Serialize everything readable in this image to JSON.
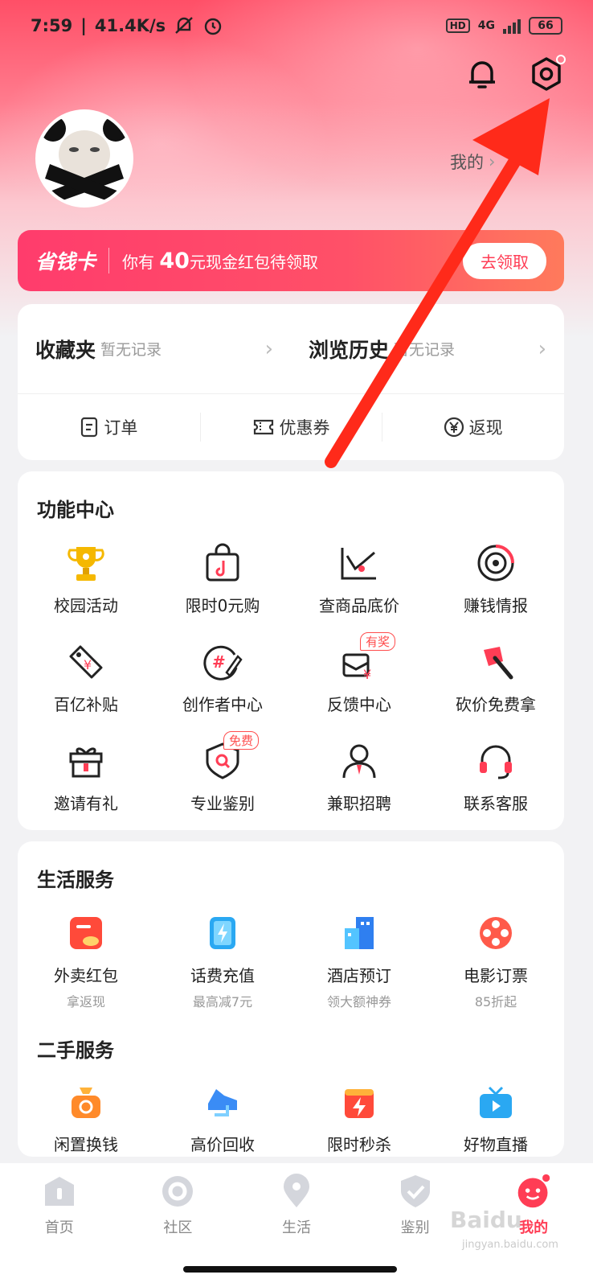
{
  "status_bar": {
    "time": "7:59",
    "speed": "41.4K/s",
    "hd": "HD",
    "network": "4G",
    "battery": "66"
  },
  "header": {
    "wallet_label": "我的"
  },
  "save_card": {
    "title": "省钱卡",
    "msg_prefix": "你有",
    "amount": "40",
    "msg_suffix": "元现金红包待领取",
    "button": "去领取"
  },
  "quick": {
    "favorites": {
      "label": "收藏夹",
      "sub": "暂无记录"
    },
    "history": {
      "label": "浏览历史",
      "sub": "暂无记录"
    },
    "links": [
      {
        "label": "订单",
        "icon": "order-icon"
      },
      {
        "label": "优惠券",
        "icon": "coupon-icon"
      },
      {
        "label": "返现",
        "icon": "yen-icon"
      }
    ]
  },
  "function_center": {
    "title": "功能中心",
    "items": [
      {
        "label": "校园活动",
        "icon": "trophy-icon"
      },
      {
        "label": "限时0元购",
        "icon": "shopping-bag-icon"
      },
      {
        "label": "查商品底价",
        "icon": "price-chart-icon"
      },
      {
        "label": "赚钱情报",
        "icon": "radar-icon"
      },
      {
        "label": "百亿补贴",
        "icon": "tag-icon"
      },
      {
        "label": "创作者中心",
        "icon": "hashtag-pen-icon"
      },
      {
        "label": "反馈中心",
        "icon": "feedback-icon",
        "badge": "有奖"
      },
      {
        "label": "砍价免费拿",
        "icon": "axe-icon"
      },
      {
        "label": "邀请有礼",
        "icon": "gift-icon"
      },
      {
        "label": "专业鉴别",
        "icon": "shield-search-icon",
        "badge": "免费"
      },
      {
        "label": "兼职招聘",
        "icon": "person-icon"
      },
      {
        "label": "联系客服",
        "icon": "headset-icon"
      }
    ]
  },
  "life_services": {
    "title": "生活服务",
    "items": [
      {
        "label": "外卖红包",
        "sub": "拿返现",
        "icon": "takeout-icon",
        "color": "#ff4a3a"
      },
      {
        "label": "话费充值",
        "sub": "最高减7元",
        "icon": "phone-charge-icon",
        "color": "#2aa8f2"
      },
      {
        "label": "酒店预订",
        "sub": "领大额神券",
        "icon": "hotel-icon",
        "color": "#2f7ff0"
      },
      {
        "label": "电影订票",
        "sub": "85折起",
        "icon": "film-reel-icon",
        "color": "#ff5a4a"
      }
    ]
  },
  "secondhand": {
    "title": "二手服务",
    "items": [
      {
        "label": "闲置换钱",
        "icon": "money-bag-icon",
        "color": "#ff8a2a"
      },
      {
        "label": "高价回收",
        "icon": "sneaker-icon",
        "color": "#3a8cf5"
      },
      {
        "label": "限时秒杀",
        "icon": "flash-sale-icon",
        "color": "#ff4a3a"
      },
      {
        "label": "好物直播",
        "icon": "live-tv-icon",
        "color": "#2aa8f2"
      }
    ]
  },
  "nav": [
    {
      "label": "首页",
      "icon": "home-icon"
    },
    {
      "label": "社区",
      "icon": "community-icon"
    },
    {
      "label": "生活",
      "icon": "location-icon"
    },
    {
      "label": "鉴别",
      "icon": "verify-shield-icon"
    },
    {
      "label": "我的",
      "icon": "profile-icon",
      "active": true
    }
  ],
  "watermark": {
    "text": "Baidu",
    "sub": "jingyan.baidu.com"
  },
  "colors": {
    "accent": "#ff3d55",
    "arrow": "#ff2a1a"
  }
}
